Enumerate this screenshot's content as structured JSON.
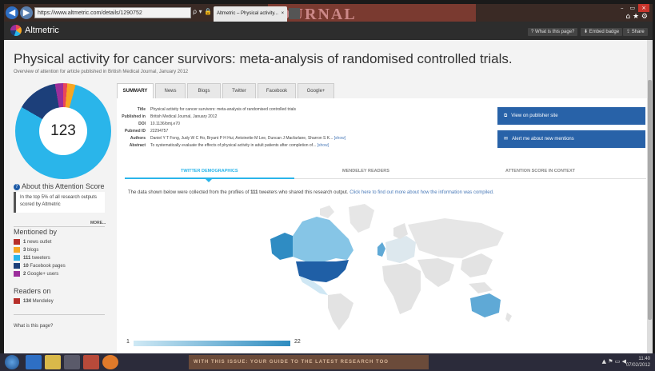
{
  "browser": {
    "back_icon": "back-arrow-icon",
    "forward_icon": "forward-arrow-icon",
    "url": "https://www.altmetric.com/details/1290752",
    "address_tools": "ρ ▾ 🔒 C",
    "tab_title": "Altmetric – Physical activity...",
    "tab_close": "×",
    "background_text": "JOURNAL",
    "window_buttons": [
      "–",
      "▭",
      "×"
    ],
    "right_icons": "⌂ ★ ⚙"
  },
  "altmetric_header": {
    "logo_text": "Altmetric",
    "buttons": [
      "? What is this page?",
      "⬇ Embed badge",
      "⇪ Share"
    ]
  },
  "article": {
    "title": "Physical activity for cancer survivors: meta-analysis of randomised controlled trials.",
    "subtitle": "Overview of attention for article published in British Medical Journal, January 2012"
  },
  "score": {
    "value": "123",
    "about_label": "About this Attention Score",
    "about_text": "In the top 5% of all research outputs scored by Altmetric",
    "more_label": "MORE..."
  },
  "mentioned_by": {
    "heading": "Mentioned by",
    "items": [
      {
        "count": "1",
        "label": "news outlet",
        "color": "#b72f2a"
      },
      {
        "count": "3",
        "label": "blogs",
        "color": "#f6a623"
      },
      {
        "count": "111",
        "label": "tweeters",
        "color": "#2ab5ea"
      },
      {
        "count": "10",
        "label": "Facebook pages",
        "color": "#1c3f7a"
      },
      {
        "count": "2",
        "label": "Google+ users",
        "color": "#9b2e9b"
      }
    ]
  },
  "readers": {
    "heading": "Readers on",
    "items": [
      {
        "count": "134",
        "label": "Mendeley",
        "color": "#b72f2a"
      }
    ]
  },
  "sidebar_footer": "What is this page?",
  "tabs": [
    "SUMMARY",
    "News",
    "Blogs",
    "Twitter",
    "Facebook",
    "Google+"
  ],
  "metadata": {
    "title_k": "Title",
    "title_v": "Physical activity for cancer survivors: meta-analysis of randomised controlled trials",
    "published_k": "Published in",
    "published_v": "British Medical Journal, January 2012",
    "doi_k": "DOI",
    "doi_v": "10.1136/bmj.e70",
    "pubmed_k": "Pubmed ID",
    "pubmed_v": "22294757",
    "authors_k": "Authors",
    "authors_v": "Daniel Y T Fong, Judy W C Ho, Bryant P H Hui, Antoinette M Lee, Duncan J Macfarlane, Sharron S K...",
    "abstract_k": "Abstract",
    "abstract_v": "To systematically evaluate the effects of physical activity in adult patients after completion of...",
    "show_label": "[show]"
  },
  "actions": {
    "publisher": "View on publisher site",
    "alert": "Alert me about new mentions"
  },
  "demographics": {
    "tabs": [
      "TWITTER DEMOGRAPHICS",
      "MENDELEY READERS",
      "ATTENTION SCORE IN CONTEXT"
    ],
    "note_prefix": "The data shown below were collected from the profiles of",
    "note_count": "111",
    "note_suffix": "tweeters who shared this research output.",
    "note_link": "Click here to find out more about how the information was compiled.",
    "legend_min": "1",
    "legend_max": "22"
  },
  "taskbar": {
    "middle_text": "WITH THIS ISSUE: YOUR GUIDE TO THE LATEST RESEARCH TOO",
    "tray": "▲ ⚑ ▭ ◀",
    "clock_time": "11:40",
    "clock_date": "07/02/2012"
  }
}
